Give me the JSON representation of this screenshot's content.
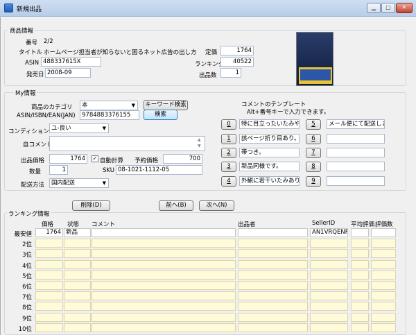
{
  "window": {
    "title": "新規出品"
  },
  "product": {
    "group_label": "商品情報",
    "number_label": "番号",
    "number_value": "2/2",
    "title_label": "タイトル",
    "title_value": "ホームページ担当者が知らないと困るネット広告の出し方",
    "asin_label": "ASIN",
    "asin_value": "488337615X",
    "list_price_label": "定価",
    "list_price_value": "1764",
    "release_label": "発売日",
    "release_value": "2008-09",
    "ranking_label": "ランキング",
    "ranking_value": "40522",
    "sellers_label": "出品数",
    "sellers_value": "1"
  },
  "my": {
    "group_label": "My情報",
    "category_label": "商品のカテゴリ",
    "category_value": "本",
    "keyword_search_label": "キーワード検索",
    "isbn_label": "ASIN/ISBN/EAN(JAN)",
    "isbn_value": "9784883376155",
    "search_label": "検索",
    "condition_label": "コンディション",
    "condition_value": "ユ-良い",
    "comment_label": "自コメント",
    "comment_value": "",
    "price_label": "出品価格",
    "price_value": "1764",
    "auto_calc_label": "自動計算",
    "reserve_label": "予約価格",
    "reserve_value": "700",
    "qty_label": "数量",
    "qty_value": "1",
    "sku_label": "SKU",
    "sku_value": "08-1021-1112-05",
    "shipping_label": "配送方法",
    "shipping_value": "国内配送"
  },
  "templates": {
    "heading": "コメントのテンプレート",
    "hint": "Alt+番号キーで入力できます。",
    "items": [
      {
        "key": "0",
        "text": "特に目立ったいたみやよご"
      },
      {
        "key": "1",
        "text": "該ページ折り目あり。"
      },
      {
        "key": "2",
        "text": "帯つき。"
      },
      {
        "key": "3",
        "text": "新品同様です。"
      },
      {
        "key": "4",
        "text": "外観に若干いたみあり。"
      },
      {
        "key": "5",
        "text": "メール便にて配送します。"
      },
      {
        "key": "6",
        "text": ""
      },
      {
        "key": "7",
        "text": ""
      },
      {
        "key": "8",
        "text": ""
      },
      {
        "key": "9",
        "text": ""
      }
    ]
  },
  "actions": {
    "delete": "削除(D)",
    "prev": "前へ(B)",
    "next": "次へ(N)"
  },
  "ranking": {
    "group_label": "ランキング情報",
    "columns": [
      "価格",
      "状態",
      "コメント",
      "出品者",
      "SellerID",
      "平均評価",
      "評価数"
    ],
    "rows": [
      {
        "label": "最安値",
        "price": "1764",
        "state": "新品",
        "comment": "",
        "seller": "",
        "seller_id": "AN1VRQENF",
        "avg": "",
        "count": ""
      },
      {
        "label": "2位",
        "price": "",
        "state": "",
        "comment": "",
        "seller": "",
        "seller_id": "",
        "avg": "",
        "count": ""
      },
      {
        "label": "3位",
        "price": "",
        "state": "",
        "comment": "",
        "seller": "",
        "seller_id": "",
        "avg": "",
        "count": ""
      },
      {
        "label": "4位",
        "price": "",
        "state": "",
        "comment": "",
        "seller": "",
        "seller_id": "",
        "avg": "",
        "count": ""
      },
      {
        "label": "5位",
        "price": "",
        "state": "",
        "comment": "",
        "seller": "",
        "seller_id": "",
        "avg": "",
        "count": ""
      },
      {
        "label": "6位",
        "price": "",
        "state": "",
        "comment": "",
        "seller": "",
        "seller_id": "",
        "avg": "",
        "count": ""
      },
      {
        "label": "7位",
        "price": "",
        "state": "",
        "comment": "",
        "seller": "",
        "seller_id": "",
        "avg": "",
        "count": ""
      },
      {
        "label": "8位",
        "price": "",
        "state": "",
        "comment": "",
        "seller": "",
        "seller_id": "",
        "avg": "",
        "count": ""
      },
      {
        "label": "9位",
        "price": "",
        "state": "",
        "comment": "",
        "seller": "",
        "seller_id": "",
        "avg": "",
        "count": ""
      },
      {
        "label": "10位",
        "price": "",
        "state": "",
        "comment": "",
        "seller": "",
        "seller_id": "",
        "avg": "",
        "count": ""
      }
    ]
  }
}
